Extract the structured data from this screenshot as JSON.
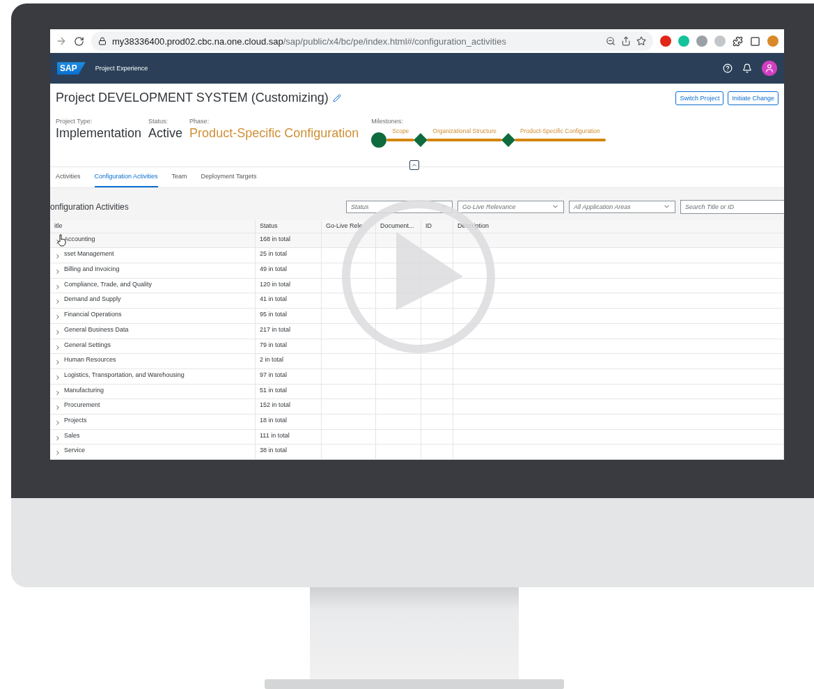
{
  "browser": {
    "url_host": "my38336400.prod02.cbc.na.one.cloud.sap",
    "url_path": "/sap/public/x4/bc/pe/index.html#/configuration_activities"
  },
  "shell": {
    "logo": "SAP",
    "app_title": "Project Experience"
  },
  "header": {
    "title": "Project DEVELOPMENT SYSTEM (Customizing)",
    "buttons": [
      "Switch Project",
      "Initiate Change"
    ],
    "attributes": [
      {
        "label": "Project Type:",
        "value": "Implementation",
        "kind": "plain"
      },
      {
        "label": "Status:",
        "value": "Active",
        "kind": "plain"
      },
      {
        "label": "Phase:",
        "value": "Product-Specific Configuration",
        "kind": "highlight"
      }
    ],
    "milestones_label": "Milestones:",
    "milestones": [
      {
        "label": "Scope",
        "kind": "circle"
      },
      {
        "label": "Organizational Structure",
        "kind": "diamond"
      },
      {
        "label": "Product-Specific Configuration",
        "kind": "diamond"
      }
    ]
  },
  "tabs": [
    {
      "label": "Activities",
      "selected": false
    },
    {
      "label": "Configuration Activities",
      "selected": true
    },
    {
      "label": "Team",
      "selected": false
    },
    {
      "label": "Deployment Targets",
      "selected": false
    }
  ],
  "section_title": "onfiguration Activities",
  "filters": [
    {
      "placeholder": "Status"
    },
    {
      "placeholder": "Go-Live Relevance"
    },
    {
      "placeholder": "All Application Areas"
    }
  ],
  "search": {
    "placeholder": "Search Title or ID"
  },
  "table": {
    "columns": [
      "itle",
      "Status",
      "Go-Live Rele",
      "Document...",
      "ID",
      "Description"
    ],
    "rows": [
      {
        "title": "Accounting",
        "status": "168 in total"
      },
      {
        "title": "sset Management",
        "status": "25 in total"
      },
      {
        "title": "Billing and Invoicing",
        "status": "49 in total"
      },
      {
        "title": "Compliance, Trade, and Quality",
        "status": "120 in total"
      },
      {
        "title": "Demand and Supply",
        "status": "41 in total"
      },
      {
        "title": "Financial Operations",
        "status": "95 in total"
      },
      {
        "title": "General Business Data",
        "status": "217 in total"
      },
      {
        "title": "General Settings",
        "status": "79 in total"
      },
      {
        "title": "Human Resources",
        "status": "2 in total"
      },
      {
        "title": "Logistics, Transportation, and Warehousing",
        "status": "97 in total"
      },
      {
        "title": "Manufacturing",
        "status": "51 in total"
      },
      {
        "title": "Procurement",
        "status": "152 in total"
      },
      {
        "title": "Projects",
        "status": "18 in total"
      },
      {
        "title": "Sales",
        "status": "111 in total"
      },
      {
        "title": "Service",
        "status": "38 in total"
      }
    ]
  }
}
